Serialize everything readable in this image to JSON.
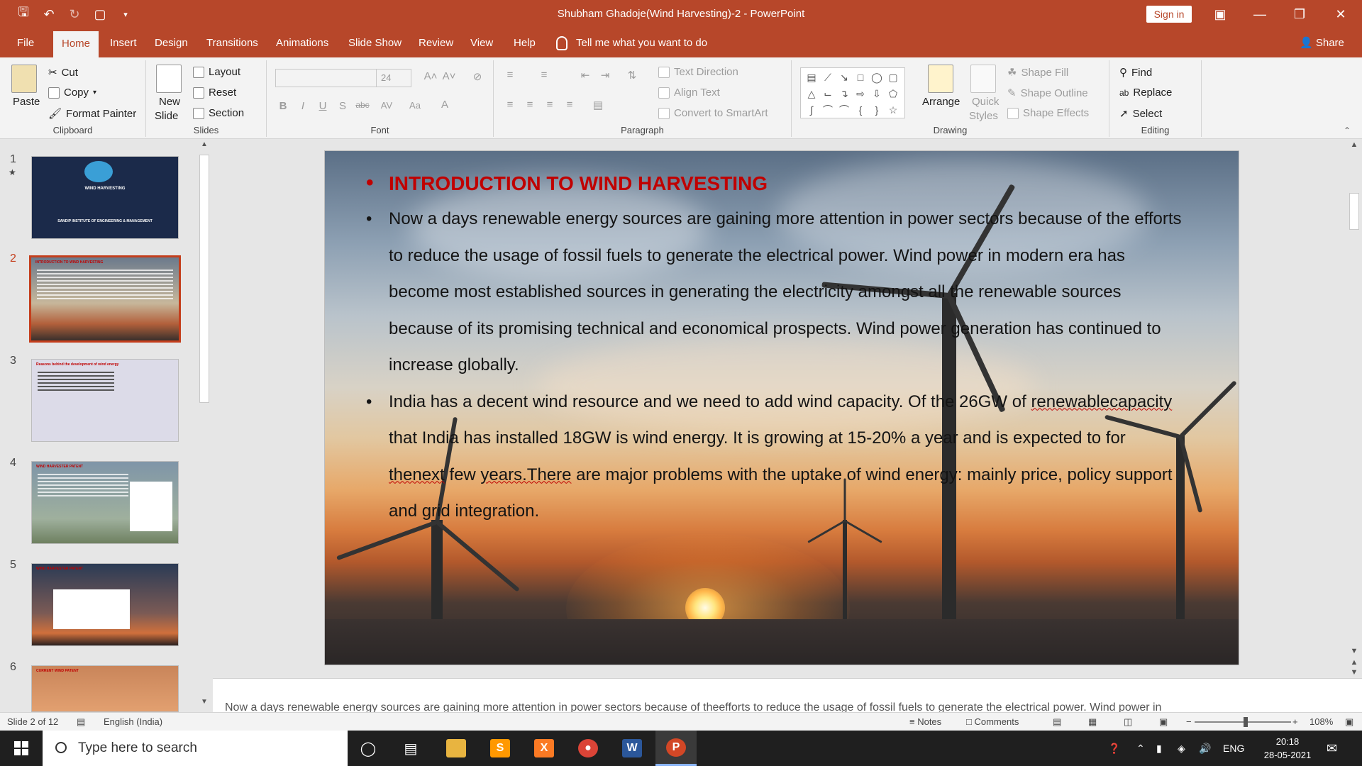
{
  "window": {
    "title": "Shubham Ghadoje(Wind Harvesting)-2  -  PowerPoint",
    "sign_in": "Sign in"
  },
  "tabs": [
    {
      "label": "File"
    },
    {
      "label": "Home"
    },
    {
      "label": "Insert"
    },
    {
      "label": "Design"
    },
    {
      "label": "Transitions"
    },
    {
      "label": "Animations"
    },
    {
      "label": "Slide Show"
    },
    {
      "label": "Review"
    },
    {
      "label": "View"
    },
    {
      "label": "Help"
    }
  ],
  "tell_me": "Tell me what you want to do",
  "share": "Share",
  "ribbon": {
    "clipboard": {
      "label": "Clipboard",
      "paste": "Paste",
      "cut": "Cut",
      "copy": "Copy",
      "format_painter": "Format Painter"
    },
    "slides": {
      "label": "Slides",
      "new_slide_1": "New",
      "new_slide_2": "Slide",
      "layout": "Layout",
      "reset": "Reset",
      "section": "Section"
    },
    "font": {
      "label": "Font",
      "font_name": "",
      "font_size": "24"
    },
    "paragraph": {
      "label": "Paragraph",
      "text_direction": "Text Direction",
      "align_text": "Align Text",
      "convert_smartart": "Convert to SmartArt"
    },
    "drawing": {
      "label": "Drawing",
      "arrange": "Arrange",
      "quick_styles_1": "Quick",
      "quick_styles_2": "Styles",
      "shape_fill": "Shape Fill",
      "shape_outline": "Shape Outline",
      "shape_effects": "Shape Effects"
    },
    "editing": {
      "label": "Editing",
      "find": "Find",
      "replace": "Replace",
      "select": "Select"
    }
  },
  "thumbnails": [
    {
      "num": "1",
      "title": "WIND HARVESTING",
      "sub": "SANDIP INSTITUTE OF ENGINEERING & MANAGEMENT",
      "bg": "#1b2a4a"
    },
    {
      "num": "2",
      "title": "INTRODUCTION TO WIND HARVESTING",
      "bg": "#6b6f78"
    },
    {
      "num": "3",
      "title": "Reasons behind the development of wind energy",
      "bg": "#d9d8e6"
    },
    {
      "num": "4",
      "title": "WIND HARVESTER PATENT",
      "bg": "#7f95a8"
    },
    {
      "num": "5",
      "title": "WIND HARVESTER PATENT",
      "bg": "#2b3b55"
    },
    {
      "num": "6",
      "title": "CURRENT WIND PATENT",
      "bg": "#c9855a"
    }
  ],
  "slide": {
    "heading": "INTRODUCTION TO WIND HARVESTING",
    "para1": " Now a days renewable energy sources are gaining more attention in power sectors because of the efforts to reduce the usage of fossil fuels to generate the electrical power. Wind power in modern era has become most established sources in generating the electricity amongst all the renewable sources because of its promising technical and economical prospects. Wind power generation has continued to increase globally.",
    "para2_a": "India has a decent wind resource and we need to add wind capacity. Of the 26GW of ",
    "para2_sq1": "renewablecapacity",
    "para2_b": " that India has installed 18GW is wind energy. It is growing at 15-20% a year and is expected to for ",
    "para2_sq2": "thenext",
    "para2_c": " few ",
    "para2_sq3": "years.There",
    "para2_d": " are major problems with the uptake of wind energy: mainly price, policy support and grid integration."
  },
  "notes_text": "Now a days renewable energy sources are gaining more attention in power sectors because of theefforts to reduce the usage of fossil fuels to generate the electrical power. Wind power in",
  "status": {
    "slide_info": "Slide 2 of 12",
    "language": "English (India)",
    "notes": "Notes",
    "comments": "Comments",
    "zoom": "108%"
  },
  "taskbar": {
    "search_placeholder": "Type here to search",
    "lang": "ENG",
    "time": "20:18",
    "date": "28-05-2021"
  },
  "colors": {
    "accent": "#b7472a",
    "heading_red": "#c00000"
  }
}
